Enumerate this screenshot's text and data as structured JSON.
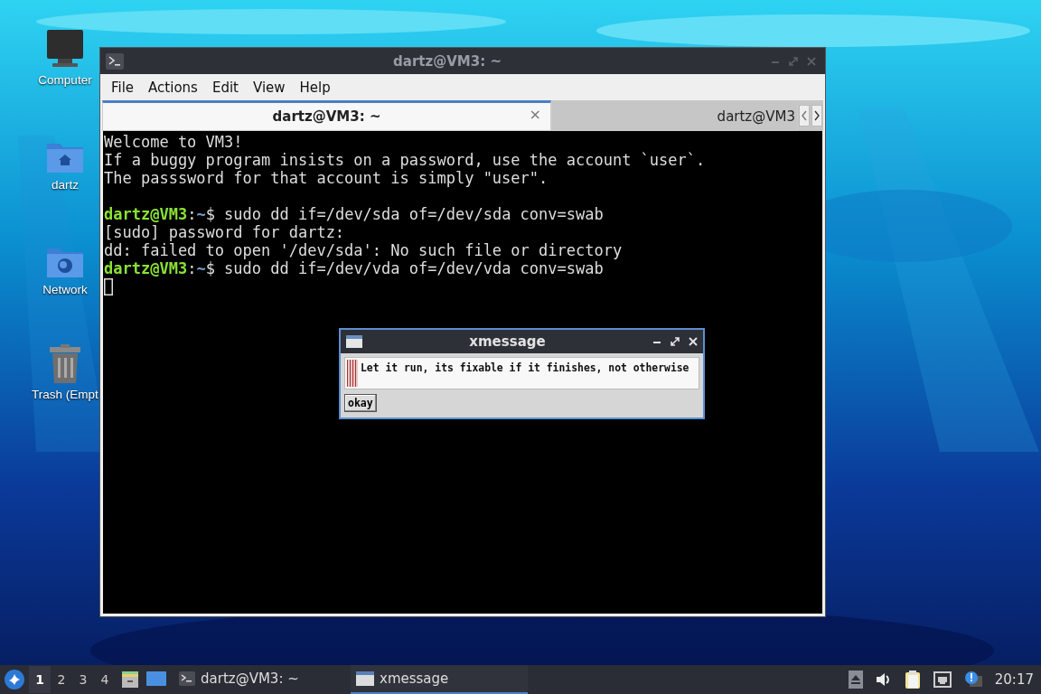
{
  "desktop_icons": [
    {
      "label": "Computer",
      "kind": "computer"
    },
    {
      "label": "dartz",
      "kind": "home"
    },
    {
      "label": "Network",
      "kind": "network"
    },
    {
      "label": "Trash (Empt",
      "kind": "trash"
    }
  ],
  "terminal_window": {
    "title": "dartz@VM3: ~",
    "menu": [
      "File",
      "Actions",
      "Edit",
      "View",
      "Help"
    ],
    "tabs": [
      {
        "label": "dartz@VM3: ~",
        "selected": true,
        "close": "×"
      },
      {
        "label": "dartz@VM3",
        "selected": false
      }
    ],
    "lines": [
      {
        "kind": "text",
        "text": "Welcome to VM3!"
      },
      {
        "kind": "text",
        "text": "If a buggy program insists on a password, use the account `user`."
      },
      {
        "kind": "text",
        "text": "The passsword for that account is simply \"user\"."
      },
      {
        "kind": "blank"
      },
      {
        "kind": "prompt",
        "segments": [
          {
            "kind": "user",
            "text": "dartz@VM3"
          },
          {
            "kind": "plain",
            "text": ":"
          },
          {
            "kind": "path",
            "text": "~"
          },
          {
            "kind": "plain",
            "text": "$ sudo dd if=/dev/sda of=/dev/sda conv=swab"
          }
        ]
      },
      {
        "kind": "text",
        "text": "[sudo] password for dartz:"
      },
      {
        "kind": "text",
        "text": "dd: failed to open '/dev/sda': No such file or directory"
      },
      {
        "kind": "prompt",
        "segments": [
          {
            "kind": "user",
            "text": "dartz@VM3"
          },
          {
            "kind": "plain",
            "text": ":"
          },
          {
            "kind": "path",
            "text": "~"
          },
          {
            "kind": "plain",
            "text": "$ sudo dd if=/dev/vda of=/dev/vda conv=swab"
          }
        ]
      },
      {
        "kind": "cursor"
      }
    ]
  },
  "xmessage": {
    "title": "xmessage",
    "message": "Let it run, its fixable if it finishes, not otherwise",
    "button": "okay"
  },
  "taskbar": {
    "workspaces": [
      {
        "label": "1",
        "selected": true
      },
      {
        "label": "2",
        "selected": false
      },
      {
        "label": "3",
        "selected": false
      },
      {
        "label": "4",
        "selected": false
      }
    ],
    "tasks": [
      {
        "label": "dartz@VM3: ~",
        "kind": "terminal",
        "selected": false
      },
      {
        "label": "xmessage",
        "kind": "window",
        "selected": true
      }
    ],
    "clock": "20:17"
  }
}
